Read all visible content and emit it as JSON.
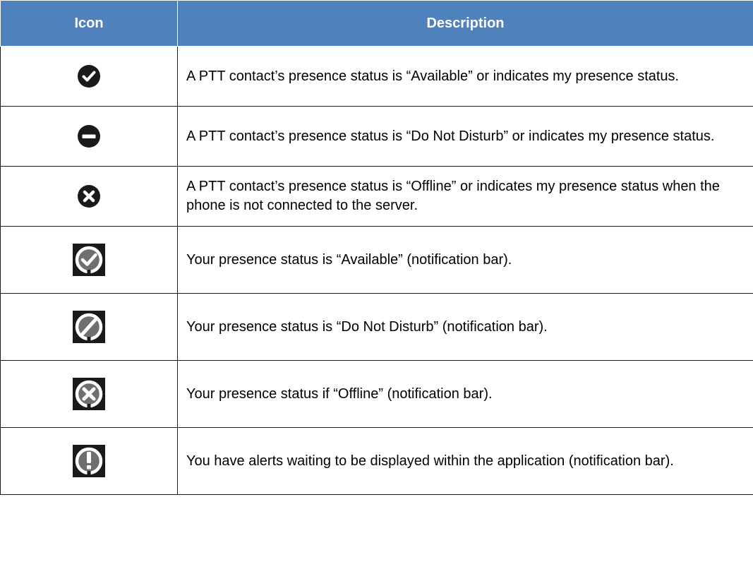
{
  "table": {
    "headers": {
      "icon": "Icon",
      "description": "Description"
    },
    "rows": [
      {
        "icon": "available-check-icon",
        "description": "A PTT contact’s presence status is “Available” or indicates my presence status."
      },
      {
        "icon": "do-not-disturb-icon",
        "description": "A PTT contact’s presence status is “Do Not Disturb” or indicates my presence status."
      },
      {
        "icon": "offline-x-icon",
        "description": "A PTT contact’s presence status is “Offline” or indicates my presence status when the phone is not connected to the server."
      },
      {
        "icon": "notification-available-icon",
        "description": "Your presence status is “Available” (notification bar)."
      },
      {
        "icon": "notification-dnd-icon",
        "description": "Your presence status is “Do Not Disturb” (notification bar)."
      },
      {
        "icon": "notification-offline-icon",
        "description": "Your presence status if “Offline” (notification bar)."
      },
      {
        "icon": "notification-alert-icon",
        "description": "You have alerts waiting to be displayed within the application (notification bar)."
      }
    ]
  },
  "colors": {
    "header_background": "#4f81bd",
    "header_text": "#ffffff",
    "border": "#1a1a1a",
    "icon_dark": "#1a1a1a"
  }
}
